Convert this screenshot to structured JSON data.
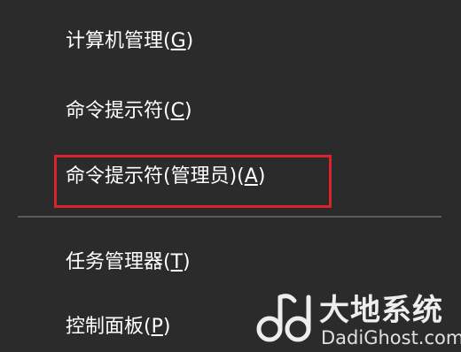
{
  "menu": {
    "items": [
      {
        "label": "计算机管理(",
        "mnemonic": "G",
        "suffix": ")"
      },
      {
        "label": "命令提示符(",
        "mnemonic": "C",
        "suffix": ")"
      },
      {
        "label": "命令提示符(管理员)(",
        "mnemonic": "A",
        "suffix": ")"
      },
      {
        "label": "任务管理器(",
        "mnemonic": "T",
        "suffix": ")"
      },
      {
        "label": "控制面板(",
        "mnemonic": "P",
        "suffix": ")"
      }
    ],
    "highlighted_item": "命令提示符(管理员)(A)"
  },
  "watermark": {
    "chinese": "大地系统",
    "english": "DadiGhost.com"
  },
  "colors": {
    "background": "#2b2b2b",
    "text": "#ffffff",
    "highlight_border": "#d9232d",
    "separator": "#5b5b5b"
  }
}
